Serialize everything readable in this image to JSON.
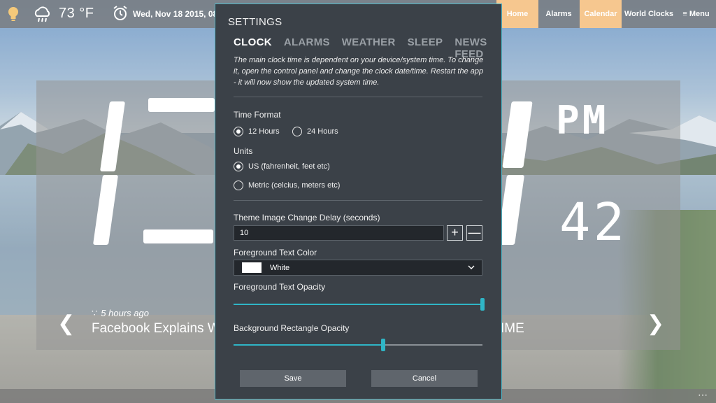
{
  "weather": {
    "temperature": "73 °F"
  },
  "datetime": {
    "date_text": "Wed, Nov 18 2015, 08:"
  },
  "nav": {
    "home": "Home",
    "alarms": "Alarms",
    "calendar": "Calendar",
    "world_clocks": "World Clocks",
    "menu": "Menu"
  },
  "clock": {
    "ampm": "PM",
    "seconds": "42"
  },
  "news": {
    "age": "5 hours ago",
    "headline": "Facebook Explains W",
    "headline_tail": "IME"
  },
  "settings": {
    "title": "SETTINGS",
    "tabs": [
      {
        "label": "CLOCK",
        "active": true
      },
      {
        "label": "ALARMS",
        "active": false
      },
      {
        "label": "WEATHER",
        "active": false
      },
      {
        "label": "SLEEP",
        "active": false
      },
      {
        "label": "NEWS FEED",
        "active": false
      }
    ],
    "info": "The main clock time is dependent on your device/system time. To change it, open the control panel and change the clock date/time. Restart the app - it will now show the updated system time.",
    "time_format": {
      "label": "Time Format",
      "options": [
        "12 Hours",
        "24 Hours"
      ],
      "selected": "12 Hours"
    },
    "units": {
      "label": "Units",
      "options": [
        "US (fahrenheit, feet etc)",
        "Metric (celcius, meters etc)"
      ],
      "selected": "US (fahrenheit, feet etc)"
    },
    "theme_delay": {
      "label": "Theme Image Change Delay (seconds)",
      "value": "10"
    },
    "fg_color": {
      "label": "Foreground Text Color",
      "value": "White",
      "swatch": "#ffffff"
    },
    "fg_opacity": {
      "label": "Foreground Text Opacity",
      "value": 1.0
    },
    "bg_opacity": {
      "label": "Background Rectangle Opacity",
      "value": 0.6
    },
    "save": "Save",
    "cancel": "Cancel"
  },
  "colors": {
    "accent": "#2fb5c6",
    "nav_highlight": "#f6c78f",
    "dialog_bg": "#3b4148"
  }
}
